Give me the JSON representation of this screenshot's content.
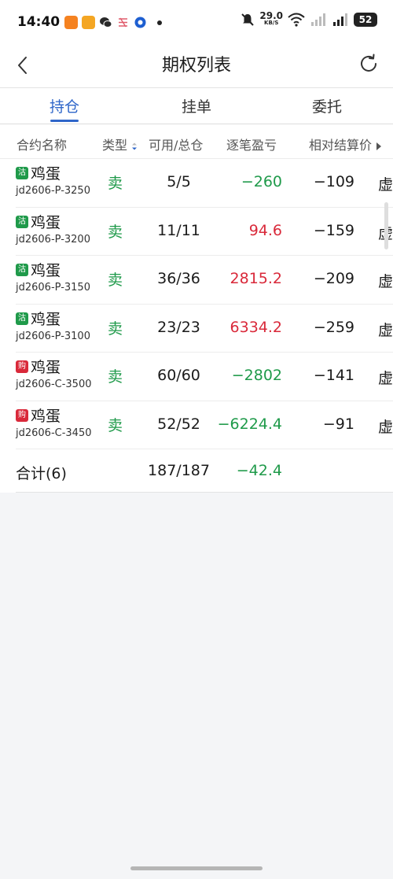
{
  "status_bar": {
    "time": "14:40",
    "app_icons": [
      {
        "icon": "orange-app-icon",
        "color": "#f58220"
      },
      {
        "icon": "yellow-app-icon",
        "color": "#f4a623"
      },
      {
        "icon": "wechat-icon",
        "color": "#2a2a2a"
      },
      {
        "icon": "pattern-app-icon",
        "color": "#e05b6c"
      },
      {
        "icon": "browser-app-icon",
        "color": "#1e5fd1"
      }
    ],
    "net_speed": "29.0",
    "net_unit": "KB/S",
    "battery": "52"
  },
  "header": {
    "title": "期权列表",
    "back_icon": "chevron-left-icon",
    "refresh_icon": "refresh-icon"
  },
  "tabs": [
    {
      "label": "持仓",
      "active": true
    },
    {
      "label": "挂单",
      "active": false
    },
    {
      "label": "委托",
      "active": false
    }
  ],
  "columns": {
    "name": "合约名称",
    "type": "类型",
    "available_total": "可用/总仓",
    "pnl": "逐笔盈亏",
    "relative_settle": "相对结算价"
  },
  "positions": [
    {
      "badge": "沽",
      "badge_color": "#1f9a4a",
      "name": "鸡蛋",
      "code": "jd2606-P-3250",
      "side": "卖",
      "available_total": "5/5",
      "pnl": "−260",
      "pnl_sign": "neg",
      "relative": "−109",
      "moneyness": "虚"
    },
    {
      "badge": "沽",
      "badge_color": "#1f9a4a",
      "name": "鸡蛋",
      "code": "jd2606-P-3200",
      "side": "卖",
      "available_total": "11/11",
      "pnl": "94.6",
      "pnl_sign": "pos",
      "relative": "−159",
      "moneyness": "虚"
    },
    {
      "badge": "沽",
      "badge_color": "#1f9a4a",
      "name": "鸡蛋",
      "code": "jd2606-P-3150",
      "side": "卖",
      "available_total": "36/36",
      "pnl": "2815.2",
      "pnl_sign": "pos",
      "relative": "−209",
      "moneyness": "虚"
    },
    {
      "badge": "沽",
      "badge_color": "#1f9a4a",
      "name": "鸡蛋",
      "code": "jd2606-P-3100",
      "side": "卖",
      "available_total": "23/23",
      "pnl": "6334.2",
      "pnl_sign": "pos",
      "relative": "−259",
      "moneyness": "虚"
    },
    {
      "badge": "购",
      "badge_color": "#d9293a",
      "name": "鸡蛋",
      "code": "jd2606-C-3500",
      "side": "卖",
      "available_total": "60/60",
      "pnl": "−2802",
      "pnl_sign": "neg",
      "relative": "−141",
      "moneyness": "虚"
    },
    {
      "badge": "购",
      "badge_color": "#d9293a",
      "name": "鸡蛋",
      "code": "jd2606-C-3450",
      "side": "卖",
      "available_total": "52/52",
      "pnl": "−6224.4",
      "pnl_sign": "neg",
      "relative": "−91",
      "moneyness": "虚"
    }
  ],
  "total": {
    "label": "合计(6)",
    "available_total": "187/187",
    "pnl": "−42.4"
  },
  "colors": {
    "accent": "#2f66c9",
    "profit": "#d9293a",
    "loss": "#1f9a4a"
  }
}
